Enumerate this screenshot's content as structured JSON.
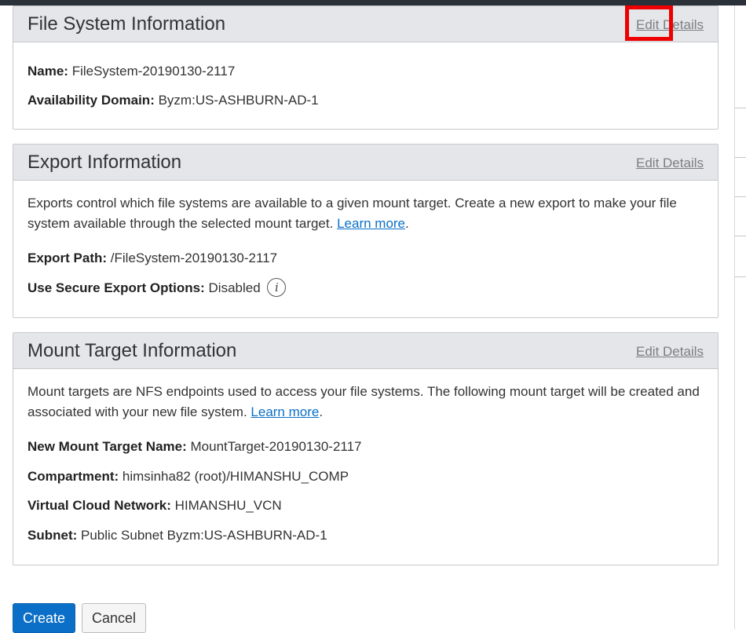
{
  "file_system": {
    "title": "File System Information",
    "edit_label": "Edit Details",
    "name_label": "Name:",
    "name_value": "FileSystem-20190130-2117",
    "ad_label": "Availability Domain:",
    "ad_value": "Byzm:US-ASHBURN-AD-1"
  },
  "export": {
    "title": "Export Information",
    "edit_label": "Edit Details",
    "description": "Exports control which file systems are available to a given mount target. Create a new export to make your file system available through the selected mount target.",
    "learn_more": "Learn more",
    "period": ".",
    "path_label": "Export Path:",
    "path_value": "/FileSystem-20190130-2117",
    "secure_label": "Use Secure Export Options:",
    "secure_value": "Disabled",
    "info_icon_glyph": "i"
  },
  "mount_target": {
    "title": "Mount Target Information",
    "edit_label": "Edit Details",
    "description": "Mount targets are NFS endpoints used to access your file systems. The following mount target will be created and associated with your new file system.",
    "learn_more": "Learn more",
    "period": ".",
    "name_label": "New Mount Target Name:",
    "name_value": "MountTarget-20190130-2117",
    "compartment_label": "Compartment:",
    "compartment_value": "himsinha82 (root)/HIMANSHU_COMP",
    "vcn_label": "Virtual Cloud Network:",
    "vcn_value": "HIMANSHU_VCN",
    "subnet_label": "Subnet:",
    "subnet_value": "Public Subnet Byzm:US-ASHBURN-AD-1"
  },
  "actions": {
    "create_label": "Create",
    "cancel_label": "Cancel"
  },
  "colors": {
    "primary_button": "#0b6fc7",
    "link": "#0b6fc7",
    "highlight": "#ee0000",
    "panel_header": "#e4e6e9"
  }
}
